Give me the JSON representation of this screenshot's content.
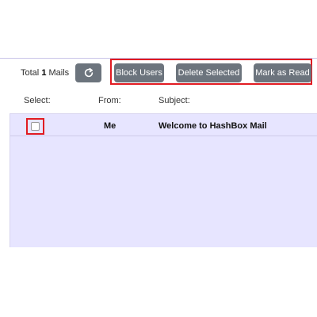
{
  "summary": {
    "prefix": "Total",
    "count": "1",
    "suffix": "Mails"
  },
  "toolbar": {
    "refresh_icon": "refresh-icon",
    "block_label": "Block Users",
    "delete_label": "Delete Selected",
    "read_label": "Mark as Read"
  },
  "columns": {
    "select": "Select:",
    "from": "From:",
    "subject": "Subject:"
  },
  "mails": [
    {
      "selected": false,
      "from": "Me",
      "subject": "Welcome to HashBox Mail",
      "unread": true
    }
  ],
  "colors": {
    "button_bg": "#6c747d",
    "highlight_border": "#e11b22",
    "panel_bg": "#e7e5ff"
  }
}
